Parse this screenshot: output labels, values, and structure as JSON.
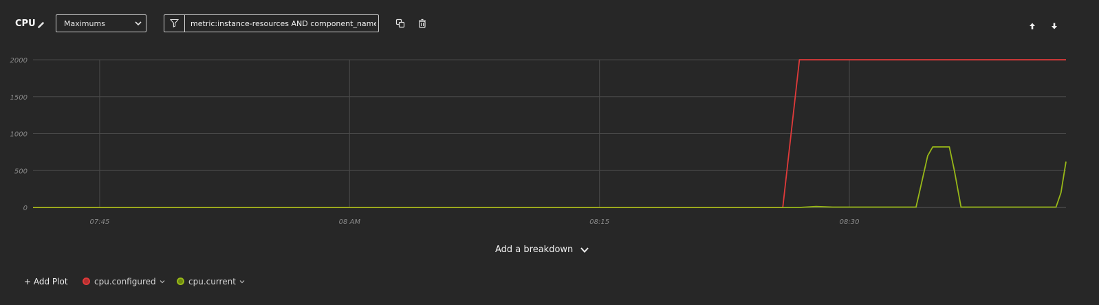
{
  "header": {
    "title": "CPU",
    "aggregation": "Maximums",
    "filter_query": "metric:instance-resources AND component_name:my-"
  },
  "icons": {
    "edit": "pencil-icon",
    "select_caret": "chevron-down-icon",
    "filter": "filter-icon",
    "duplicate": "duplicate-icon",
    "delete": "trash-icon",
    "move_up": "arrow-up-icon",
    "move_down": "arrow-down-icon"
  },
  "breakdown_label": "Add a breakdown",
  "footer": {
    "add_plot_label": "+ Add Plot",
    "series": [
      {
        "label": "cpu.configured",
        "color": "#e03a3a"
      },
      {
        "label": "cpu.current",
        "color": "#98b818"
      }
    ]
  },
  "chart_data": {
    "type": "line",
    "x_range": [
      "07:41",
      "08:43"
    ],
    "x_ticks": [
      {
        "t": "07:45",
        "label": "07:45"
      },
      {
        "t": "08:00",
        "label": "08 AM"
      },
      {
        "t": "08:15",
        "label": "08:15"
      },
      {
        "t": "08:30",
        "label": "08:30"
      }
    ],
    "ylim": [
      0,
      2000
    ],
    "y_ticks": [
      0,
      500,
      1000,
      1500,
      2000
    ],
    "grid": true,
    "series": [
      {
        "name": "cpu.configured",
        "color": "#e03a3a",
        "points": [
          [
            "07:41",
            0
          ],
          [
            "08:26",
            0
          ],
          [
            "08:26.5",
            1000
          ],
          [
            "08:27",
            2000
          ],
          [
            "08:43",
            2000
          ]
        ]
      },
      {
        "name": "cpu.current",
        "color": "#98b818",
        "points": [
          [
            "07:41",
            0
          ],
          [
            "08:27",
            0
          ],
          [
            "08:28",
            12
          ],
          [
            "08:29",
            5
          ],
          [
            "08:34",
            5
          ],
          [
            "08:34.3",
            300
          ],
          [
            "08:34.7",
            700
          ],
          [
            "08:35",
            820
          ],
          [
            "08:36",
            820
          ],
          [
            "08:36.3",
            500
          ],
          [
            "08:36.7",
            5
          ],
          [
            "08:42.4",
            5
          ],
          [
            "08:42.7",
            200
          ],
          [
            "08:43",
            620
          ]
        ]
      }
    ]
  }
}
